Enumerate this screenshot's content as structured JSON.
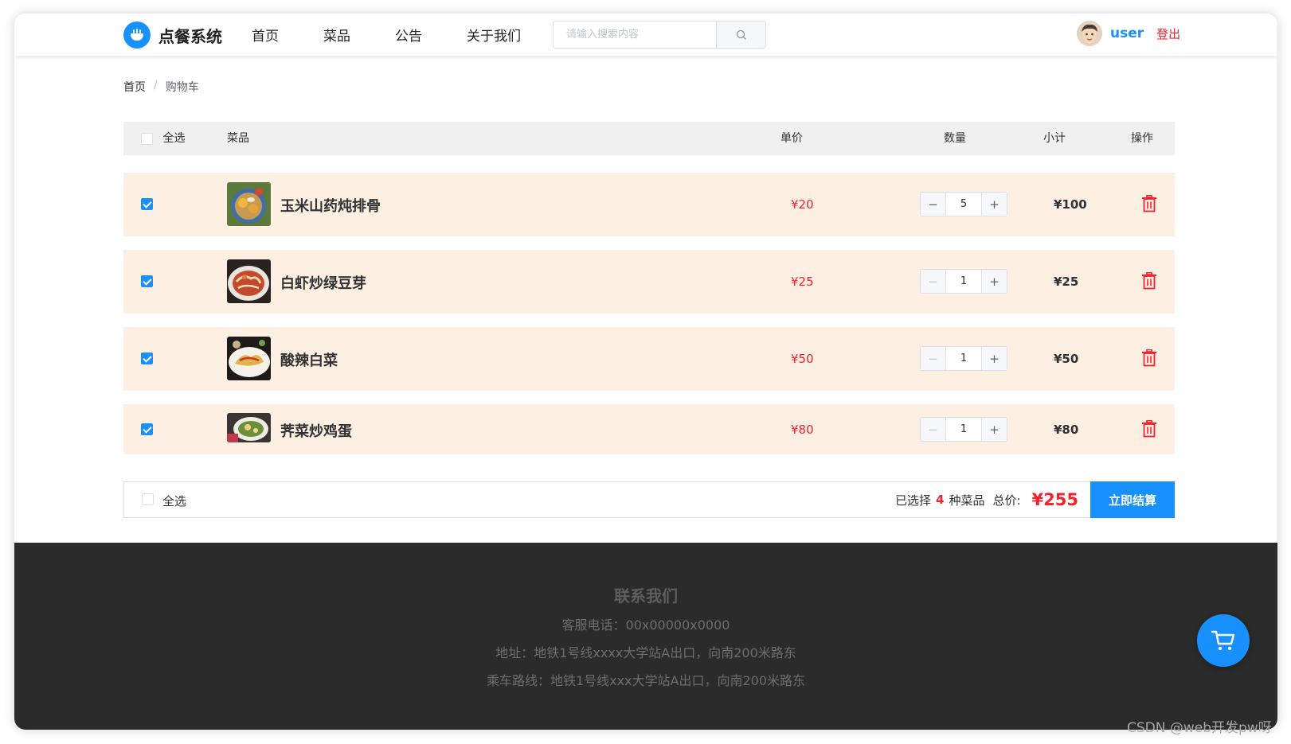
{
  "header": {
    "logo_text": "点餐系统",
    "nav": [
      "首页",
      "菜品",
      "公告",
      "关于我们"
    ],
    "search_placeholder": "请输入搜索内容",
    "username": "user",
    "logout": "登出"
  },
  "breadcrumb": {
    "home": "首页",
    "sep": "/",
    "current": "购物车"
  },
  "table": {
    "headers": {
      "select_all": "全选",
      "dish": "菜品",
      "price": "单价",
      "qty": "数量",
      "subtotal": "小计",
      "action": "操作"
    },
    "rows": [
      {
        "name": "玉米山药炖排骨",
        "price": "¥20",
        "qty": "5",
        "subtotal": "¥100",
        "checked": true
      },
      {
        "name": "白虾炒绿豆芽",
        "price": "¥25",
        "qty": "1",
        "subtotal": "¥25",
        "checked": true
      },
      {
        "name": "酸辣白菜",
        "price": "¥50",
        "qty": "1",
        "subtotal": "¥50",
        "checked": true
      },
      {
        "name": "荠菜炒鸡蛋",
        "price": "¥80",
        "qty": "1",
        "subtotal": "¥80",
        "checked": true
      }
    ]
  },
  "summary": {
    "select_all": "全选",
    "selected_prefix": "已选择",
    "selected_count": "4",
    "selected_suffix": "种菜品",
    "total_label": "总价:",
    "total": "¥255",
    "checkout": "立即结算"
  },
  "footer": {
    "title": "联系我们",
    "phone": "客服电话：00x00000x0000",
    "address": "地址：地铁1号线xxxx大学站A出口，向南200米路东",
    "route": "乘车路线：地铁1号线xxx大学站A出口，向南200米路东"
  },
  "watermark": "CSDN @web开发pw呀",
  "colors": {
    "primary": "#1890ff",
    "price_red": "#f5222d",
    "row_bg": "#fdefe1",
    "footer_bg": "#2b2b2b"
  }
}
